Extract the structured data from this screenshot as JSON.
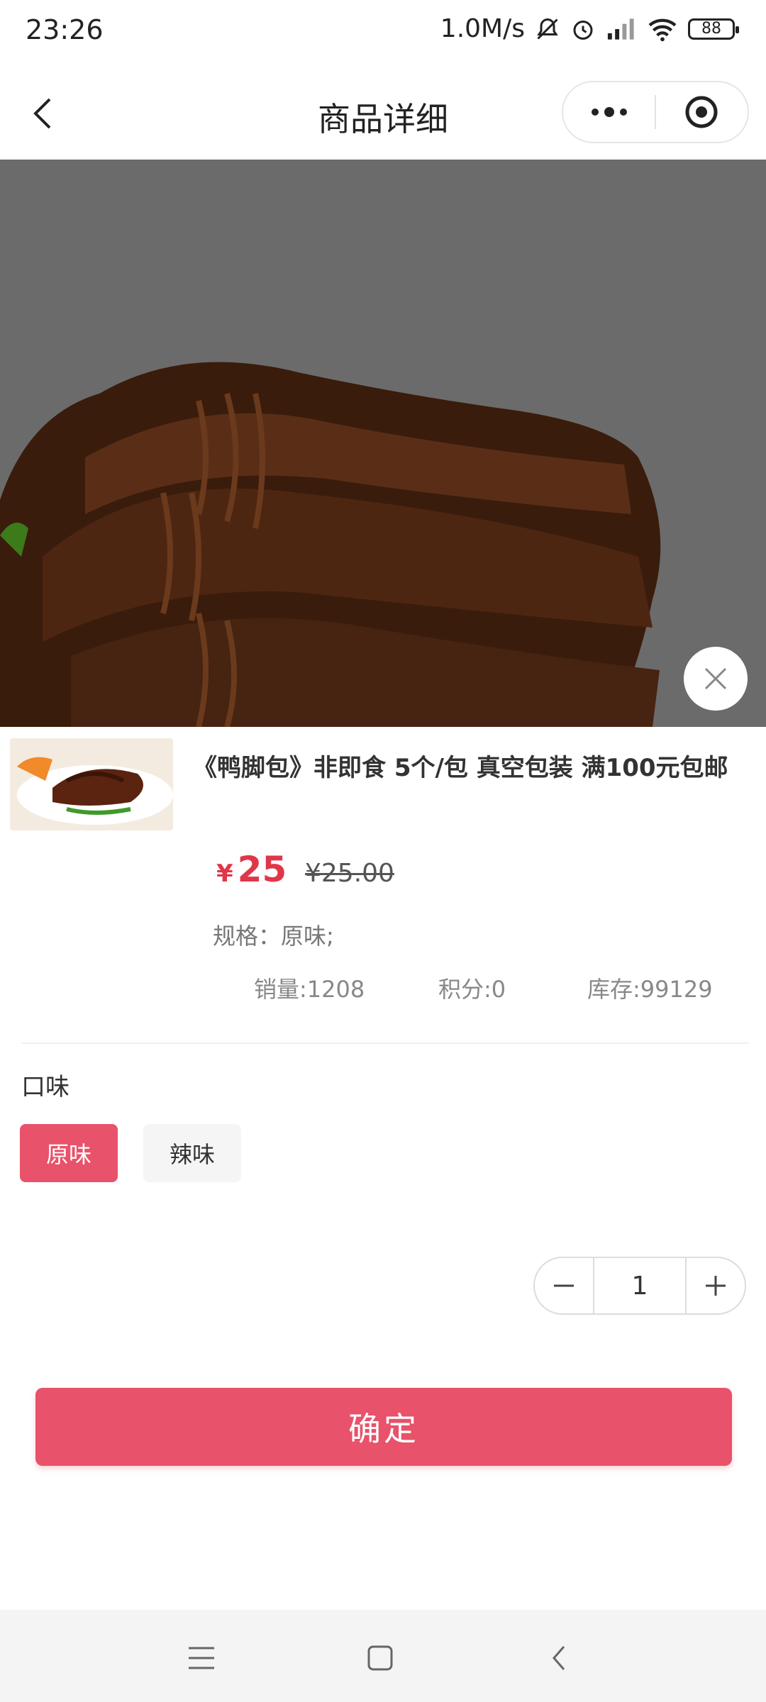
{
  "status": {
    "time": "23:26",
    "speed": "1.0M/s",
    "battery": "88"
  },
  "nav": {
    "title": "商品详细"
  },
  "product": {
    "title": "《鸭脚包》非即食 5个/包 真空包装 满100元包邮",
    "currency": "¥",
    "price": "25",
    "original_price": "¥25.00",
    "spec": "规格：原味;",
    "sales": "销量:1208",
    "points": "积分:0",
    "stock": "库存:99129"
  },
  "options": {
    "label": "口味",
    "items": [
      "原味",
      "辣味"
    ],
    "selected": "原味"
  },
  "quantity": {
    "value": "1"
  },
  "confirm_label": "确定",
  "colors": {
    "accent": "#e8526a",
    "price": "#e0364a",
    "overlay": "#6b6b6b"
  },
  "icons": [
    "back-icon",
    "more-icon",
    "target-icon",
    "close-icon",
    "minus-icon",
    "plus-icon",
    "menu-icon",
    "home-icon",
    "system-back-icon"
  ]
}
